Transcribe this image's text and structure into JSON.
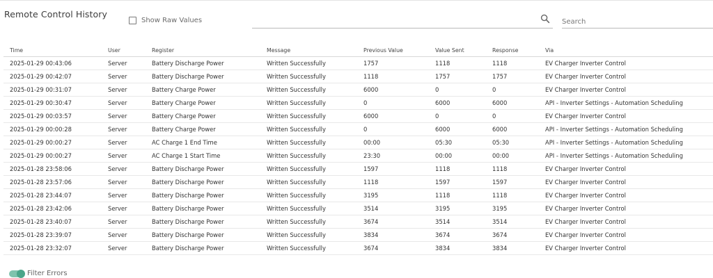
{
  "page": {
    "title": "Remote Control History",
    "show_raw_label": "Show Raw Values",
    "search_placeholder": "Search",
    "filter_label": "Filter Errors"
  },
  "table": {
    "headers": [
      "Time",
      "User",
      "Register",
      "Message",
      "Previous Value",
      "Value Sent",
      "Response",
      "Via"
    ],
    "rows": [
      [
        "2025-01-29 00:43:06",
        "Server",
        "Battery Discharge Power",
        "Written Successfully",
        "1757",
        "1118",
        "1118",
        "EV Charger Inverter Control"
      ],
      [
        "2025-01-29 00:42:07",
        "Server",
        "Battery Discharge Power",
        "Written Successfully",
        "1118",
        "1757",
        "1757",
        "EV Charger Inverter Control"
      ],
      [
        "2025-01-29 00:31:07",
        "Server",
        "Battery Charge Power",
        "Written Successfully",
        "6000",
        "0",
        "0",
        "EV Charger Inverter Control"
      ],
      [
        "2025-01-29 00:30:47",
        "Server",
        "Battery Charge Power",
        "Written Successfully",
        "0",
        "6000",
        "6000",
        "API - Inverter Settings - Automation Scheduling"
      ],
      [
        "2025-01-29 00:03:57",
        "Server",
        "Battery Charge Power",
        "Written Successfully",
        "6000",
        "0",
        "0",
        "EV Charger Inverter Control"
      ],
      [
        "2025-01-29 00:00:28",
        "Server",
        "Battery Charge Power",
        "Written Successfully",
        "0",
        "6000",
        "6000",
        "API - Inverter Settings - Automation Scheduling"
      ],
      [
        "2025-01-29 00:00:27",
        "Server",
        "AC Charge 1 End Time",
        "Written Successfully",
        "00:00",
        "05:30",
        "05:30",
        "API - Inverter Settings - Automation Scheduling"
      ],
      [
        "2025-01-29 00:00:27",
        "Server",
        "AC Charge 1 Start Time",
        "Written Successfully",
        "23:30",
        "00:00",
        "00:00",
        "API - Inverter Settings - Automation Scheduling"
      ],
      [
        "2025-01-28 23:58:06",
        "Server",
        "Battery Discharge Power",
        "Written Successfully",
        "1597",
        "1118",
        "1118",
        "EV Charger Inverter Control"
      ],
      [
        "2025-01-28 23:57:06",
        "Server",
        "Battery Discharge Power",
        "Written Successfully",
        "1118",
        "1597",
        "1597",
        "EV Charger Inverter Control"
      ],
      [
        "2025-01-28 23:44:07",
        "Server",
        "Battery Discharge Power",
        "Written Successfully",
        "3195",
        "1118",
        "1118",
        "EV Charger Inverter Control"
      ],
      [
        "2025-01-28 23:42:06",
        "Server",
        "Battery Discharge Power",
        "Written Successfully",
        "3514",
        "3195",
        "3195",
        "EV Charger Inverter Control"
      ],
      [
        "2025-01-28 23:40:07",
        "Server",
        "Battery Discharge Power",
        "Written Successfully",
        "3674",
        "3514",
        "3514",
        "EV Charger Inverter Control"
      ],
      [
        "2025-01-28 23:39:07",
        "Server",
        "Battery Discharge Power",
        "Written Successfully",
        "3834",
        "3674",
        "3674",
        "EV Charger Inverter Control"
      ],
      [
        "2025-01-28 23:32:07",
        "Server",
        "Battery Discharge Power",
        "Written Successfully",
        "3674",
        "3834",
        "3834",
        "EV Charger Inverter Control"
      ]
    ]
  },
  "icons": {
    "search": "search-icon",
    "checkbox": "checkbox-unchecked",
    "toggle": "toggle-on"
  },
  "colors": {
    "toggle_track": "#7fc3ad",
    "toggle_knob": "#4ba58a"
  }
}
